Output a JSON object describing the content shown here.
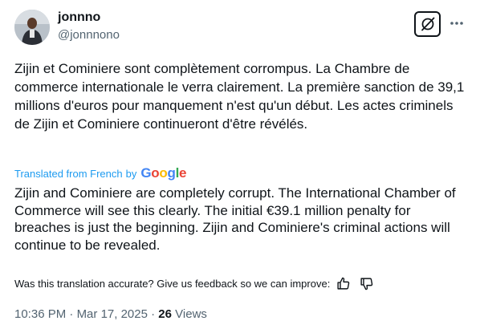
{
  "author": {
    "display_name": "jonnno",
    "handle": "@jonnnono"
  },
  "tweet": {
    "original_text": "Zijin et Cominiere sont complètement corrompus. La Chambre de commerce internationale le verra clairement. La première sanction de 39,1 millions d'euros pour manquement n'est qu'un début. Les actes criminels de Zijin et Cominiere continueront d'être révélés.",
    "translated_from": "Translated from French",
    "by": "by",
    "translator_logo_text": "Google",
    "translated_text": "Zijin and Cominiere are completely corrupt. The International Chamber of Commerce will see this clearly. The initial €39.1 million penalty for breaches is just the beginning. Zijin and Cominiere's criminal actions will continue to be revealed."
  },
  "feedback": {
    "question": "Was this translation accurate? Give us feedback so we can improve:"
  },
  "meta": {
    "time": "10:36 PM",
    "separator": "·",
    "date": "Mar 17, 2025",
    "views_count": "26",
    "views_label": "Views"
  },
  "icons": {
    "grok": "grok-icon",
    "more": "more-dots-icon",
    "thumbs_up": "thumbs-up-icon",
    "thumbs_down": "thumbs-down-icon"
  },
  "colors": {
    "text": "#0f1419",
    "secondary": "#536471",
    "link": "#1d9bf0",
    "google_blue": "#4285F4",
    "google_red": "#EA4335",
    "google_yellow": "#FBBC05",
    "google_green": "#34A853"
  }
}
